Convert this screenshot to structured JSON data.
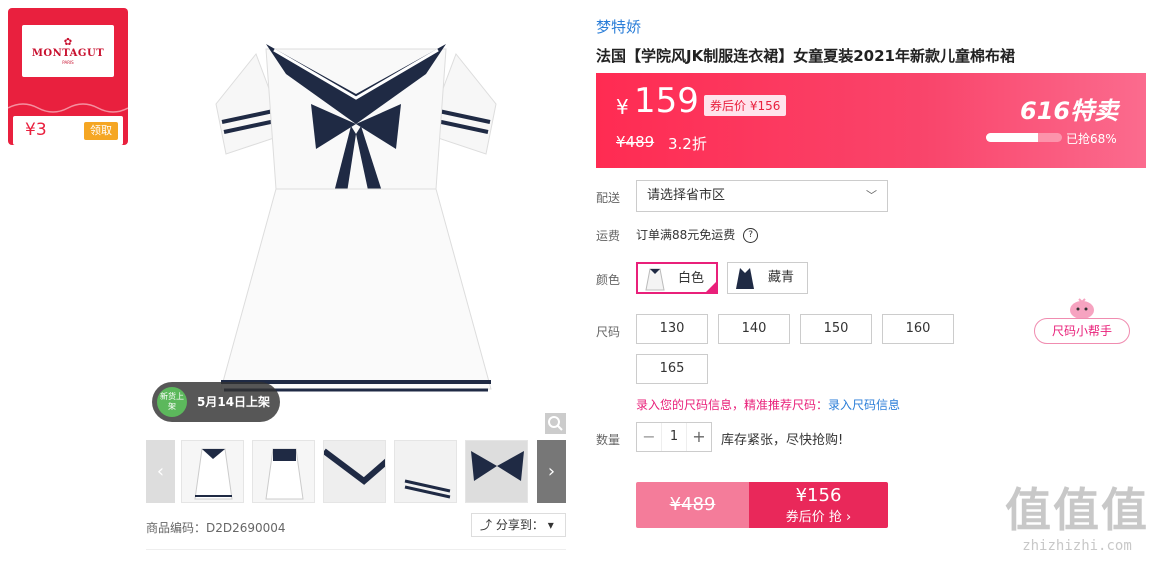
{
  "coupon": {
    "logo": "MONTAGUT",
    "logo_sub": "PARIS",
    "amount": "¥3",
    "claim_label": "领取"
  },
  "gallery": {
    "launch_badge": "新货上架",
    "launch_date": "5月14日上架",
    "prev_arrow": "‹",
    "next_arrow": "›",
    "zoom_icon": "magnifier-icon",
    "thumbnails": [
      "front-view",
      "back-view",
      "collar-detail",
      "sleeve-detail",
      "bow-detail"
    ]
  },
  "product_code": "商品编码：D2D2690004",
  "share_label": "分享到：",
  "brand": "梦特娇",
  "title": "法国【学院风JK制服连衣裙】女童夏装2021年新款儿童棉布裙",
  "price_box": {
    "currency": "¥",
    "price": "159",
    "after_coupon": "券后价 ¥156",
    "original": "¥489",
    "discount": "3.2折",
    "event": "616特卖",
    "sold_fraction": 0.68,
    "sold_label": "已抢68%"
  },
  "delivery": {
    "label": "配送",
    "placeholder": "请选择省市区"
  },
  "shipping": {
    "label": "运费",
    "text": "订单满88元免运费"
  },
  "colors": {
    "label": "颜色",
    "options": [
      {
        "name": "白色",
        "selected": true,
        "swatch": "#f4f4f4"
      },
      {
        "name": "藏青",
        "selected": false,
        "swatch": "#1f2a44"
      }
    ]
  },
  "sizes": {
    "label": "尺码",
    "options": [
      "130",
      "140",
      "150",
      "160",
      "165"
    ],
    "helper": "尺码小帮手",
    "info_text": "录入您的尺码信息，精准推荐尺码：",
    "info_link": "录入尺码信息"
  },
  "quantity": {
    "label": "数量",
    "value": "1",
    "stock_text": "库存紧张，尽快抢购!"
  },
  "buy_button": {
    "original": "¥489",
    "price": "¥156",
    "action": "券后价 抢 ›"
  },
  "watermark": {
    "big": "值值值",
    "site": "zhizhizhi.com"
  },
  "colors_theme": {
    "accent": "#e9203e",
    "pink": "#e9207a",
    "link": "#2b7ed8"
  }
}
